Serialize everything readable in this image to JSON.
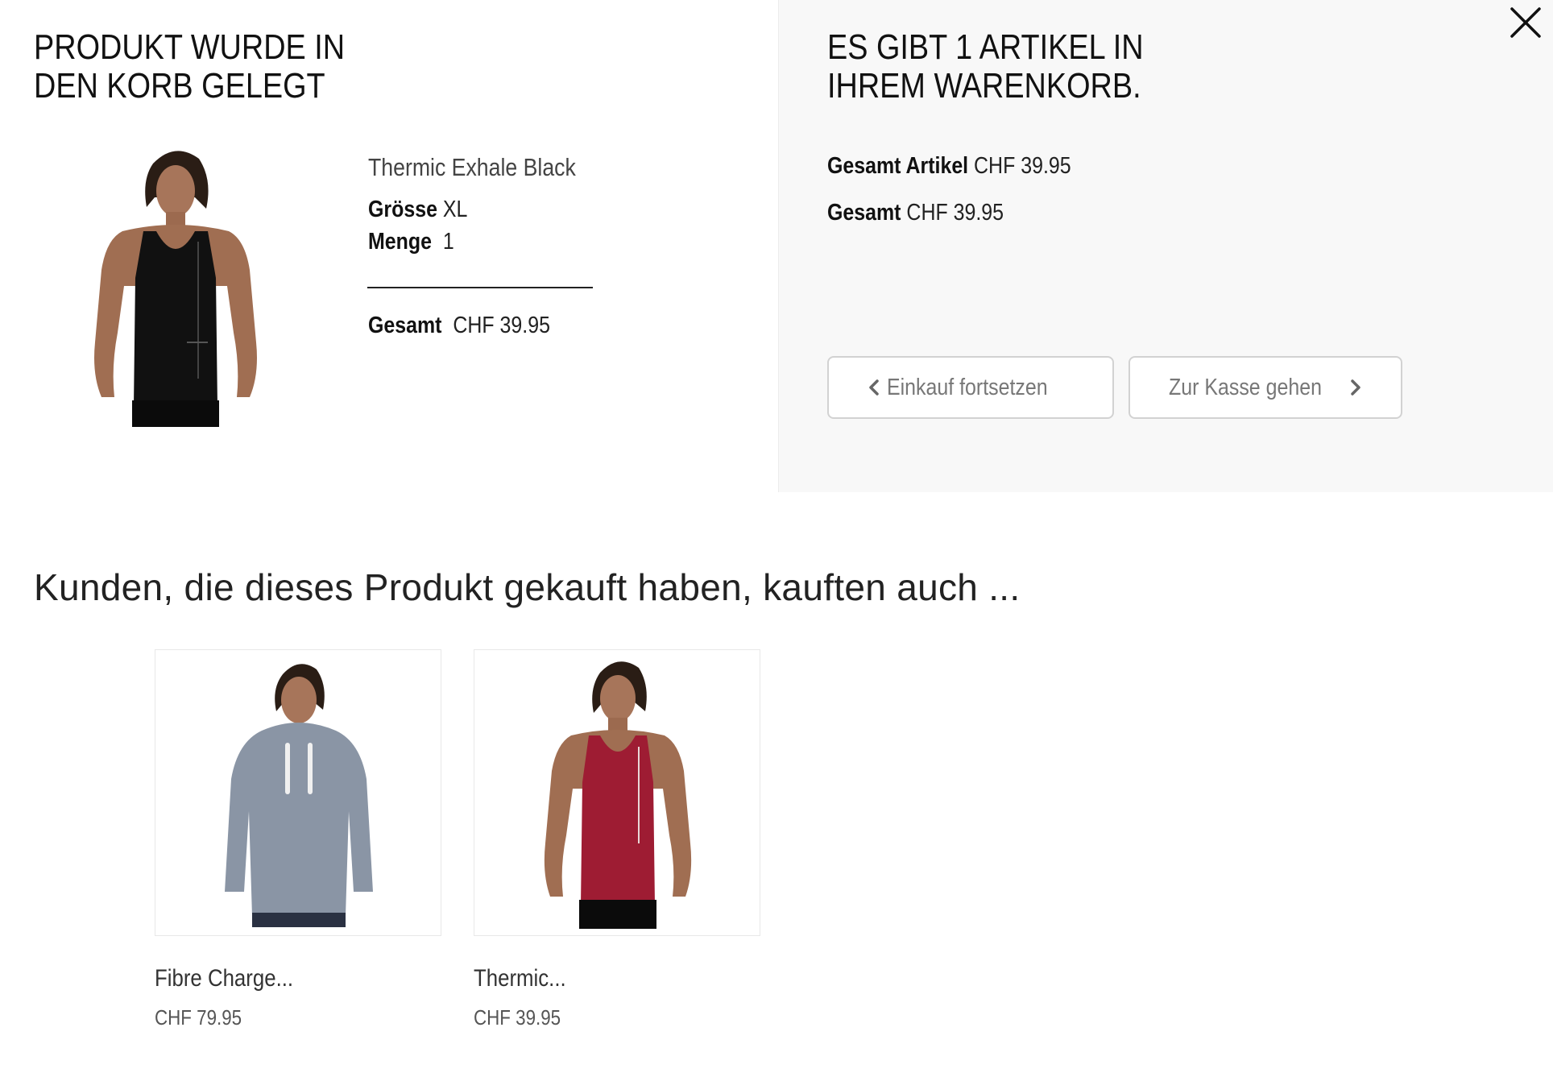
{
  "close": {
    "icon": "close-icon"
  },
  "added": {
    "heading": "PRODUKT WURDE IN DEN KORB GELEGT",
    "product": {
      "name": "Thermic Exhale Black",
      "size_label": "Grösse",
      "size_value": "XL",
      "qty_label": "Menge",
      "qty_value": "1",
      "total_label": "Gesamt",
      "total_value": "CHF 39.95"
    }
  },
  "cart": {
    "heading": "ES GIBT 1 ARTIKEL IN IHREM WARENKORB.",
    "items_total_label": "Gesamt Artikel",
    "items_total_value": "CHF 39.95",
    "total_label": "Gesamt",
    "total_value": "CHF 39.95",
    "continue_label": "Einkauf fortsetzen",
    "checkout_label": "Zur Kasse gehen"
  },
  "recommendations": {
    "heading": "Kunden, die dieses Produkt gekauft haben, kauften auch ...",
    "items": [
      {
        "name": "Fibre Charge...",
        "price": "CHF 79.95",
        "color": "#8a95a5"
      },
      {
        "name": "Thermic...",
        "price": "CHF 39.95",
        "color": "#9e1c33"
      }
    ]
  }
}
